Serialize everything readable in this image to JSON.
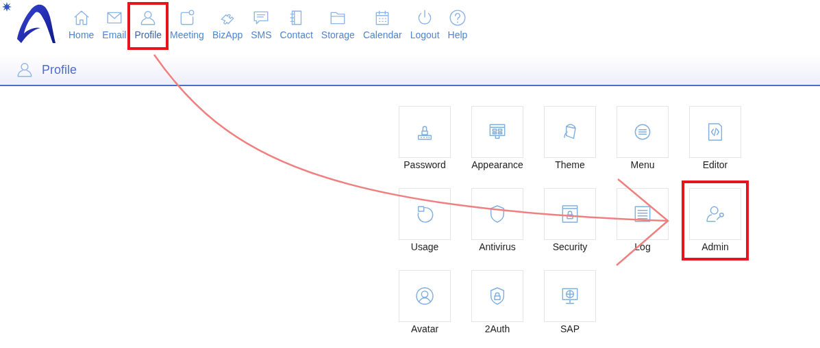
{
  "nav": [
    {
      "label": "Home",
      "highlighted": false
    },
    {
      "label": "Email",
      "highlighted": false
    },
    {
      "label": "Profile",
      "highlighted": true
    },
    {
      "label": "Meeting",
      "highlighted": false
    },
    {
      "label": "BizApp",
      "highlighted": false
    },
    {
      "label": "SMS",
      "highlighted": false
    },
    {
      "label": "Contact",
      "highlighted": false
    },
    {
      "label": "Storage",
      "highlighted": false
    },
    {
      "label": "Calendar",
      "highlighted": false
    },
    {
      "label": "Logout",
      "highlighted": false
    },
    {
      "label": "Help",
      "highlighted": false
    }
  ],
  "page_title": "Profile",
  "tiles": [
    {
      "label": "Password",
      "highlighted": false
    },
    {
      "label": "Appearance",
      "highlighted": false
    },
    {
      "label": "Theme",
      "highlighted": false
    },
    {
      "label": "Menu",
      "highlighted": false
    },
    {
      "label": "Editor",
      "highlighted": false
    },
    {
      "label": "Usage",
      "highlighted": false
    },
    {
      "label": "Antivirus",
      "highlighted": false
    },
    {
      "label": "Security",
      "highlighted": false
    },
    {
      "label": "Log",
      "highlighted": false
    },
    {
      "label": "Admin",
      "highlighted": true
    },
    {
      "label": "Avatar",
      "highlighted": false
    },
    {
      "label": "2Auth",
      "highlighted": false
    },
    {
      "label": "SAP",
      "highlighted": false
    }
  ]
}
